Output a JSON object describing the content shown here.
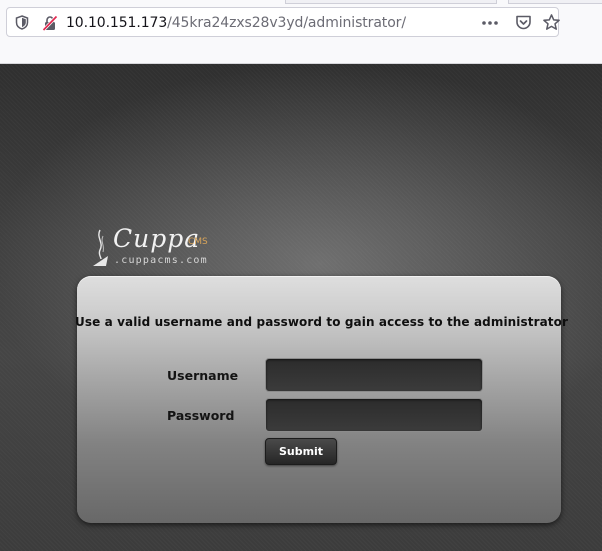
{
  "browser": {
    "url_host": "10.10.151.173",
    "url_path": "/45kra24zxs28v3yd/administrator/",
    "icons": [
      "shield-icon",
      "insecure-connection-icon",
      "more-actions-icon",
      "pocket-icon",
      "bookmark-star-icon"
    ]
  },
  "logo": {
    "brand": "Cuppa",
    "suffix": "CMS",
    "domain": ".cuppacms.com"
  },
  "login": {
    "message": "Use a valid username and password to gain access to the administrator",
    "username_label": "Username",
    "username_value": "",
    "password_label": "Password",
    "password_value": "",
    "submit_label": "Submit"
  },
  "colors": {
    "logo_accent": "#d9a55a",
    "panel_top": "#dedede",
    "panel_bottom": "#686868",
    "input_bg": "#2c2c2c"
  }
}
